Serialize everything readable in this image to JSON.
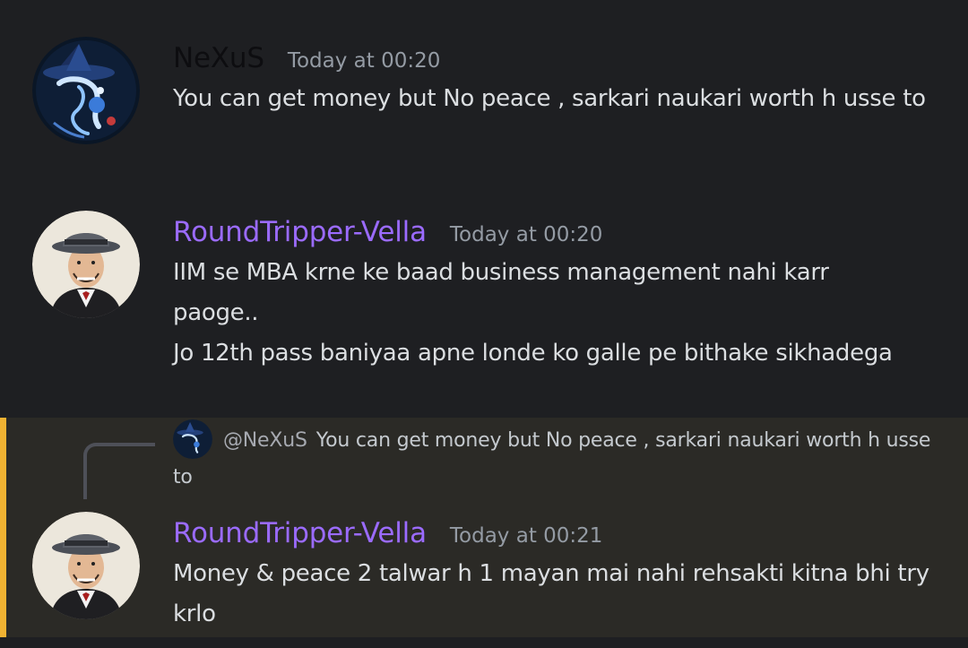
{
  "messages": [
    {
      "username": "NeXuS",
      "username_color": "#0d0d10",
      "timestamp": "Today at 00:20",
      "lines": [
        "You can get money but No peace , sarkari naukari worth h usse to"
      ]
    },
    {
      "username": "RoundTripper-Vella",
      "username_color": "#9b6bff",
      "timestamp": "Today at 00:20",
      "lines": [
        "IIM se MBA krne ke baad business management nahi karr paoge..",
        "Jo 12th pass baniyaa apne londe ko galle pe bithake sikhadega"
      ]
    },
    {
      "reply": {
        "mention": "@NeXuS",
        "text": "You can get money but No peace , sarkari naukari worth h usse to"
      },
      "username": "RoundTripper-Vella",
      "username_color": "#9b6bff",
      "timestamp": "Today at 00:21",
      "lines": [
        "Money & peace 2 talwar h 1 mayan mai nahi rehsakti kitna bhi try krlo"
      ]
    }
  ],
  "colors": {
    "background": "#1e1f22",
    "highlight_background": "#2b2a26",
    "highlight_bar": "#f0b232",
    "message_text": "#dbdee1",
    "timestamp": "#949ba4"
  },
  "icons": {
    "nexus_avatar": "witch-hat-avatar",
    "vella_avatar": "fedora-man-avatar"
  }
}
